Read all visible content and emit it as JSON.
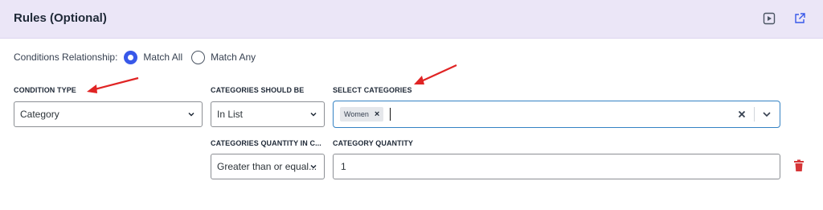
{
  "header": {
    "title": "Rules (Optional)",
    "icons": [
      "play-icon",
      "external-link-icon"
    ]
  },
  "relationship": {
    "label": "Conditions Relationship:",
    "options": [
      {
        "label": "Match All",
        "selected": true
      },
      {
        "label": "Match Any",
        "selected": false
      }
    ]
  },
  "rule": {
    "condition_type": {
      "label": "CONDITION TYPE",
      "value": "Category"
    },
    "categories_should_be": {
      "label": "CATEGORIES SHOULD BE",
      "value": "In List"
    },
    "select_categories": {
      "label": "SELECT CATEGORIES",
      "tags": [
        "Women"
      ]
    },
    "quantity_in": {
      "label": "CATEGORIES QUANTITY IN C...",
      "value": "Greater than or equal..."
    },
    "category_quantity": {
      "label": "CATEGORY QUANTITY",
      "value": "1"
    }
  },
  "colors": {
    "header_bg": "#ebe6f7",
    "accent": "#3858e9",
    "focus_border": "#3582c4",
    "delete": "#d63638",
    "annotation_arrow": "#e02424"
  }
}
